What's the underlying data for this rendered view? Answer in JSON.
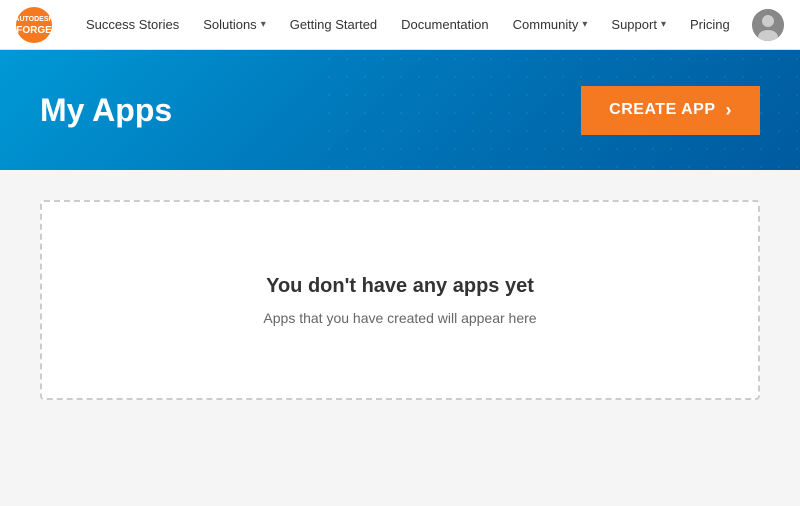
{
  "navbar": {
    "brand": {
      "autodesk": "AUTODESK®",
      "forge": "FORGE"
    },
    "links": [
      {
        "label": "Success Stories",
        "hasDropdown": false
      },
      {
        "label": "Solutions",
        "hasDropdown": true
      },
      {
        "label": "Getting Started",
        "hasDropdown": false
      },
      {
        "label": "Documentation",
        "hasDropdown": false
      },
      {
        "label": "Community",
        "hasDropdown": true
      },
      {
        "label": "Support",
        "hasDropdown": true
      },
      {
        "label": "Pricing",
        "hasDropdown": false
      }
    ]
  },
  "hero": {
    "title": "My Apps",
    "create_button_label": "CREATE APP"
  },
  "empty_state": {
    "title": "You don't have any apps yet",
    "subtitle": "Apps that you have created will appear here"
  },
  "colors": {
    "orange": "#f47920",
    "blue_dark": "#005a9e",
    "blue_mid": "#0099d6"
  }
}
